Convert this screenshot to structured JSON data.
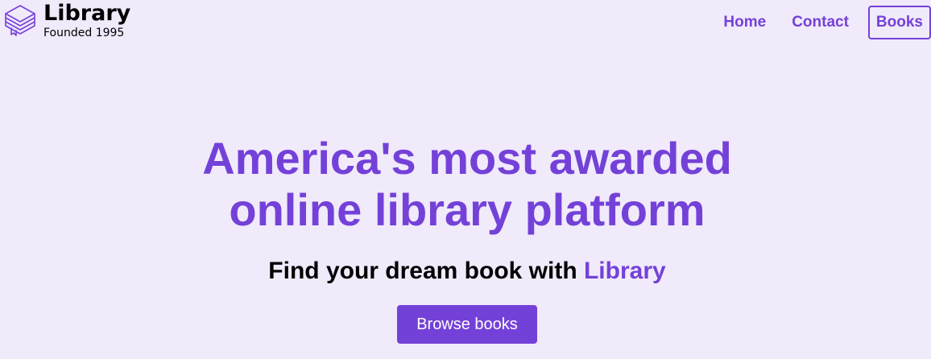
{
  "brand": {
    "name": "Library",
    "tagline": "Founded 1995",
    "logo_icon": "stacked-books-icon"
  },
  "nav": {
    "items": [
      {
        "label": "Home",
        "active": false
      },
      {
        "label": "Contact",
        "active": false
      },
      {
        "label": "Books",
        "active": true
      }
    ]
  },
  "hero": {
    "title_line1": "America's most awarded",
    "title_line2": "online library platform",
    "subtitle_prefix": "Find your dream book with ",
    "subtitle_accent": "Library",
    "cta_label": "Browse books"
  },
  "colors": {
    "accent": "#7441d8",
    "background": "#f0eafb",
    "text": "#000000",
    "button_text": "#ffffff"
  }
}
